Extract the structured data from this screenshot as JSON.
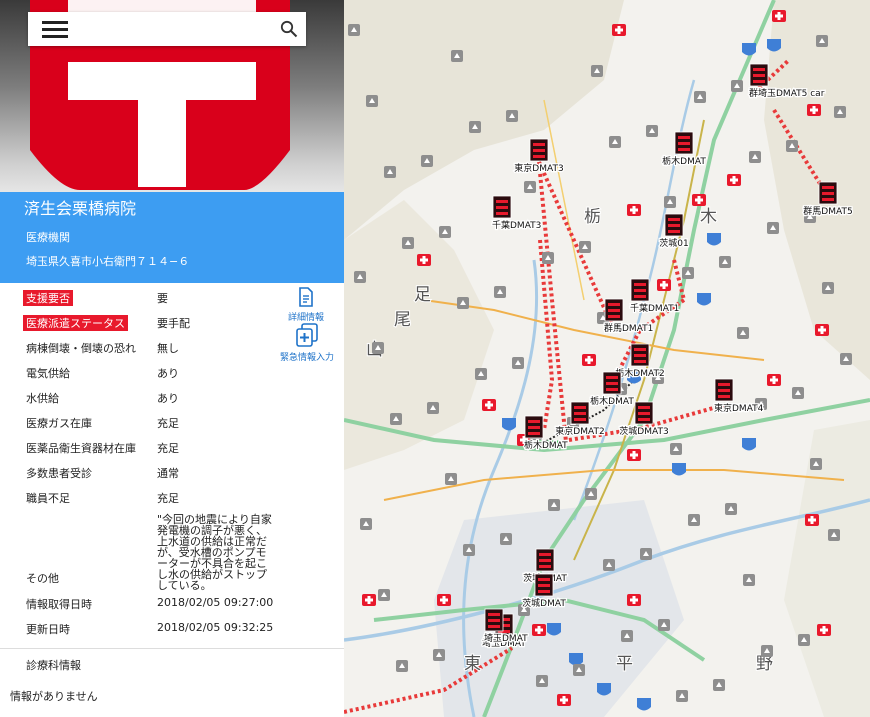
{
  "search": {
    "placeholder": ""
  },
  "hospital": {
    "name": "済生会栗橋病院",
    "type": "医療機関",
    "address": "埼玉県久喜市小右衛門７１４−６"
  },
  "info_rows": [
    {
      "label": "支援要否",
      "value": "要",
      "highlight": true
    },
    {
      "label": "医療派遣ステータス",
      "value": "要手配",
      "highlight": true
    },
    {
      "label": "病棟倒壊・倒壊の恐れ",
      "value": "無し",
      "highlight": false
    },
    {
      "label": "電気供給",
      "value": "あり",
      "highlight": false
    },
    {
      "label": "水供給",
      "value": "あり",
      "highlight": false
    },
    {
      "label": "医療ガス在庫",
      "value": "充足",
      "highlight": false
    },
    {
      "label": "医薬品衛生資器材在庫",
      "value": "充足",
      "highlight": false
    },
    {
      "label": "多数患者受診",
      "value": "通常",
      "highlight": false
    },
    {
      "label": "職員不足",
      "value": "充足",
      "highlight": false
    }
  ],
  "other": {
    "label": "その他",
    "note": "\"今回の地震により自家発電機の調子が悪く、上水道の供給は正常だが、受水槽のポンプモーターが不具合を起こし水の供給がストップしている。"
  },
  "timestamps": {
    "acquired_label": "情報取得日時",
    "acquired_value": "2018/02/05 09:27:00",
    "updated_label": "更新日時",
    "updated_value": "2018/02/05 09:32:25"
  },
  "buttons": {
    "detail": "詳細情報",
    "emergency": "緊急情報入力"
  },
  "department": {
    "title": "診療科情報",
    "empty": "情報がありません"
  },
  "map": {
    "place_labels": [
      "栃",
      "木",
      "足",
      "尾",
      "山",
      "東",
      "平",
      "野"
    ],
    "units": [
      "群埼玉DMAT5 car",
      "栃木DMAT",
      "埼玉DMAT",
      "東京DMAT3",
      "千葉DMAT3",
      "茨城DMAT",
      "群馬DMAT5",
      "茨城01",
      "千葉DMAT1",
      "群馬DMAT1",
      "栃木DMAT2",
      "栃木DMAT",
      "東京DMAT4",
      "東京DMAT2",
      "茨城DMAT3",
      "栃木DMAT",
      "茨城DMAT",
      "埼玉DMAT"
    ]
  },
  "colors": {
    "accent": "#3d9df2",
    "status_red": "#e8192c",
    "route_red": "#e83a3a",
    "logo_red": "#d9001b"
  }
}
